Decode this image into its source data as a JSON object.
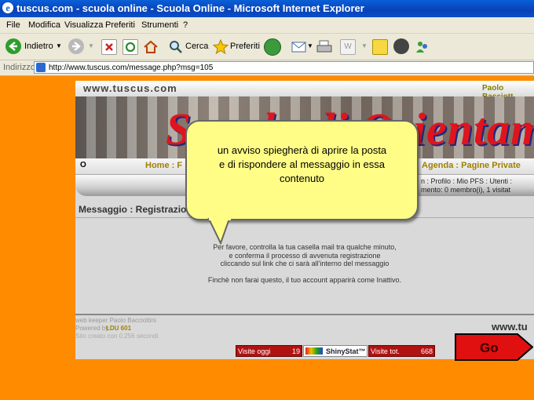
{
  "window": {
    "title": "tuscus.com - scuola online - Scuola Online - Microsoft Internet Explorer"
  },
  "menu": [
    "File",
    "Modifica",
    "Visualizza",
    "Preferiti",
    "Strumenti",
    "?"
  ],
  "toolbar": {
    "back_label": "Indietro",
    "search_label": "Cerca",
    "favorites_label": "Preferiti"
  },
  "address": {
    "label": "Indirizzo",
    "url": "http://www.tuscus.com/message.php?msg=105"
  },
  "site": {
    "logo": "www.tuscus.com",
    "author_top": "Paolo Bacciott",
    "banner": "Scuola di Orientam",
    "nav_home": "Home : F",
    "nav_right": "Agenda : Pagine Private",
    "nav_bullet": "O",
    "info_line1": "n : Profilo : Mio PFS : Utenti :",
    "info_line2": "mento: 0 membro(i), 1 visitat",
    "message_title": "Messaggio : Registrazion",
    "message_body": [
      "Per favore, controlla la tua casella mail tra qualche minuto,",
      "e conferma il processo di avvenuta registrazione",
      "cliccando sul link che ci sarà all'interno del messaggio",
      "Finchè non farai questo, il tuo account apparirà come Inattivo."
    ],
    "footer_line1": "web keeper Paolo Bacciottini",
    "footer_powered": "Powered by",
    "footer_ldu": "LDU 601",
    "footer_line3": "Sito creato con 0.256 secondi",
    "footer_logo": "www.tu",
    "visits_today_label": "Visite oggi",
    "visits_today_value": "19",
    "shinystat": "ShinyStat™",
    "visits_total_label": "Visite tot.",
    "visits_total_value": "668",
    "go_label": "Go"
  },
  "callout": {
    "line1": "un avviso spiegherà di aprire la posta",
    "line2": "e di rispondere al messaggio in essa",
    "line3": "contenuto"
  },
  "colors": {
    "page_bg": "#ff8c00",
    "callout_bg": "#fffd86",
    "banner_red": "#e0141c",
    "go_red": "#e01010"
  }
}
